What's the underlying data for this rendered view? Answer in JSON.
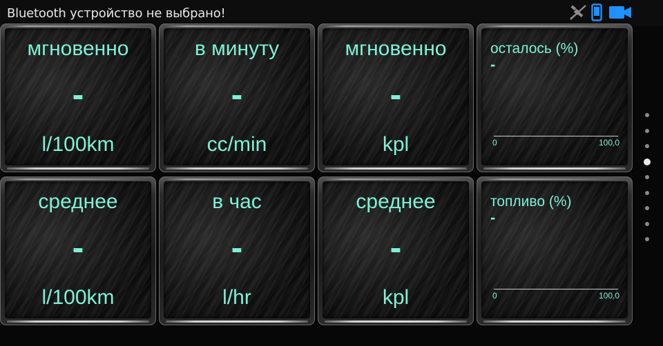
{
  "status": {
    "message": "Bluetooth устройство не выбрано!",
    "icons": [
      "gps-off-icon",
      "phone-icon",
      "camera-icon"
    ],
    "colors": {
      "gps": "#8c8c8c",
      "phone": "#1e90ff",
      "camera": "#1e90ff"
    }
  },
  "accent_color": "#7ff0d6",
  "gauges": [
    {
      "title": "мгновенно",
      "value": "-",
      "unit": "l/100km"
    },
    {
      "title": "в минуту",
      "value": "-",
      "unit": "cc/min"
    },
    {
      "title": "мгновенно",
      "value": "-",
      "unit": "kpl"
    },
    {
      "title": "среднее",
      "value": "-",
      "unit": "l/100km"
    },
    {
      "title": "в час",
      "value": "-",
      "unit": "l/hr"
    },
    {
      "title": "среднее",
      "value": "-",
      "unit": "kpl"
    }
  ],
  "bar_gauges": [
    {
      "title": "осталось (%)",
      "value": "-",
      "min": "0",
      "max": "100,0",
      "fill_fraction": 0
    },
    {
      "title": "топливо (%)",
      "value": "-",
      "min": "0",
      "max": "100,0",
      "fill_fraction": 0
    }
  ],
  "pager": {
    "count": 9,
    "active_index": 3
  }
}
